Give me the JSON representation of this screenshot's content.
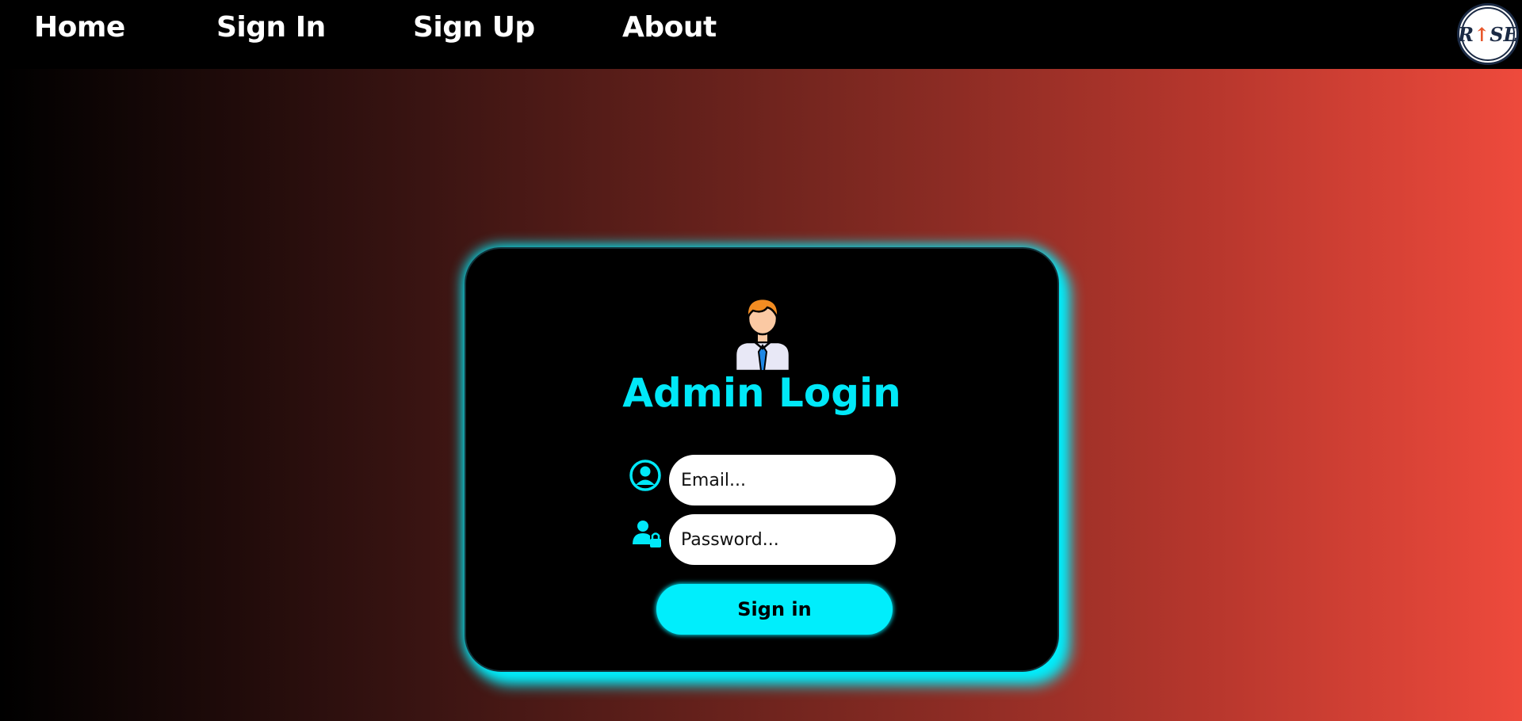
{
  "nav": {
    "items": [
      {
        "label": "Home"
      },
      {
        "label": "Sign In"
      },
      {
        "label": "Sign Up"
      },
      {
        "label": "About"
      }
    ],
    "logo_text": "RISE"
  },
  "login": {
    "title": "Admin Login",
    "email": {
      "placeholder": "Email...",
      "value": "",
      "icon": "user-circle-icon"
    },
    "password": {
      "placeholder": "Password...",
      "value": "",
      "icon": "user-lock-icon"
    },
    "submit_label": "Sign in",
    "avatar_icon": "admin-avatar-icon"
  },
  "colors": {
    "accent": "#00eefc",
    "navbar": "#000000",
    "card": "#000000",
    "gradient_start": "#000000",
    "gradient_end": "#ee4a3c"
  }
}
